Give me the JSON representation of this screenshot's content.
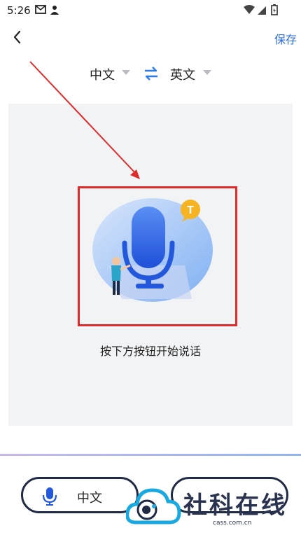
{
  "status_bar": {
    "time": "5:26"
  },
  "header": {
    "save_label": "保存"
  },
  "languages": {
    "source": "中文",
    "target": "英文"
  },
  "main": {
    "hint": "按下方按钮开始说话"
  },
  "bottom": {
    "left_button_label": "中文"
  },
  "watermark": {
    "title": "社科在线",
    "url": "cass.com.cn"
  },
  "colors": {
    "accent": "#2f6fe4",
    "annotation": "#e02b2b",
    "panel": "#f2f3f5"
  }
}
